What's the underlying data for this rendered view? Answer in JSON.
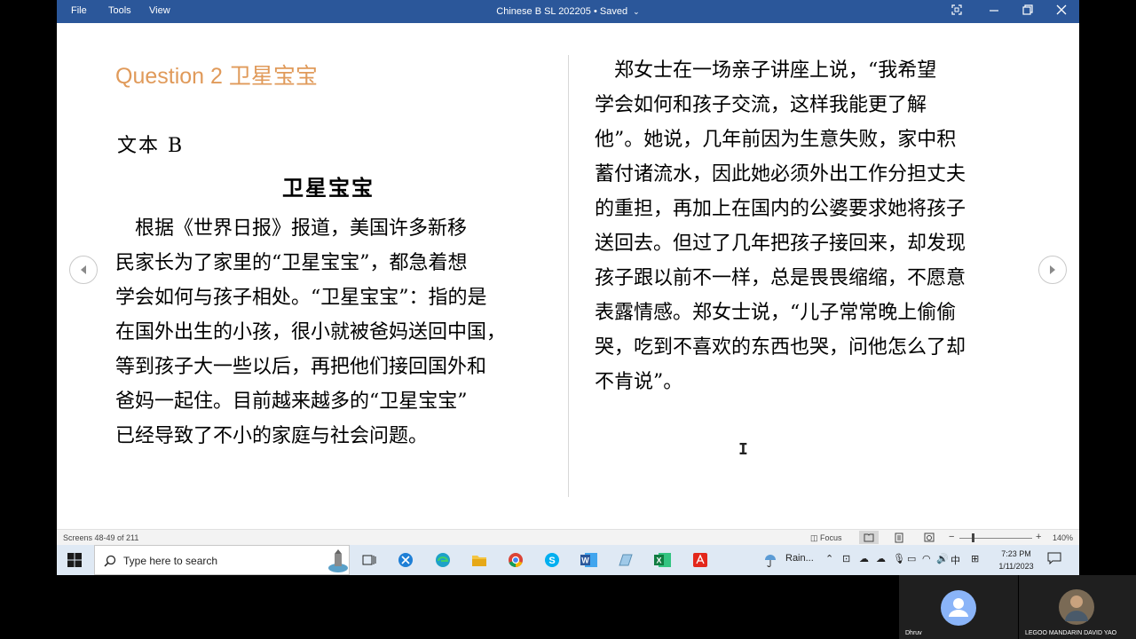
{
  "titlebar": {
    "menu": [
      "File",
      "Tools",
      "View"
    ],
    "doc_title": "Chinese B SL 202205",
    "status": "Saved"
  },
  "page": {
    "question_title": "Question 2 卫星宝宝",
    "text_label": "文本 B",
    "article_title": "卫星宝宝",
    "left_lines": [
      "　根据《世界日报》报道，美国许多新移",
      "民家长为了家里的“卫星宝宝”，都急着想",
      "学会如何与孩子相处。“卫星宝宝”：指的是",
      "在国外出生的小孩，很小就被爸妈送回中国，",
      "等到孩子大一些以后，再把他们接回国外和",
      "爸妈一起住。目前越来越多的“卫星宝宝”",
      "已经导致了不小的家庭与社会问题。"
    ],
    "right_lines": [
      "　郑女士在一场亲子讲座上说，“我希望",
      "学会如何和孩子交流，这样我能更了解",
      "他”。她说，几年前因为生意失败，家中积",
      "蓄付诸流水，因此她必须外出工作分担丈夫",
      "的重担，再加上在国内的公婆要求她将孩子",
      "送回去。但过了几年把孩子接回来，却发现",
      "孩子跟以前不一样，总是畏畏缩缩，不愿意",
      "表露情感。郑女士说，“儿子常常晚上偷偷",
      "哭，吃到不喜欢的东西也哭，问他怎么了却",
      "不肯说”。"
    ]
  },
  "statusbar": {
    "screens": "Screens 48-49 of 211",
    "focus": "Focus",
    "zoom": "140%"
  },
  "taskbar": {
    "search_placeholder": "Type here to search",
    "weather": "Rain...",
    "ime": "中",
    "time": "7:23 PM",
    "date": "1/11/2023"
  },
  "participants": [
    {
      "name": "Dhruv"
    },
    {
      "name": "LEGOO MANDARIN DAVID YAO"
    }
  ],
  "colors": {
    "titlebar": "#2b579a",
    "question_title": "#e09a5a",
    "taskbar": "#dfe9f4"
  }
}
